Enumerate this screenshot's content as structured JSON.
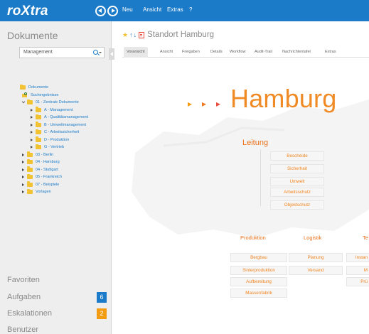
{
  "app": {
    "logo": "roXtra"
  },
  "topbar": {
    "menu": [
      "Neu",
      "Ansicht",
      "Extras",
      "?"
    ]
  },
  "sidebar": {
    "title": "Dokumente",
    "search": {
      "value": "Management"
    },
    "tree": [
      {
        "label": "Dokumente",
        "level": 0,
        "state": "none",
        "icon": "folder"
      },
      {
        "label": "Suchergebnisse",
        "level": 1,
        "state": "none",
        "icon": "search-folder"
      },
      {
        "label": "01 - Zentrale Dokumente",
        "level": 1,
        "state": "expanded",
        "icon": "folder"
      },
      {
        "label": "A - Management",
        "level": 2,
        "state": "collapsed",
        "icon": "folder"
      },
      {
        "label": "A - Qualitätsmanagement",
        "level": 2,
        "state": "collapsed",
        "icon": "folder"
      },
      {
        "label": "B - Umweltmanagement",
        "level": 2,
        "state": "collapsed",
        "icon": "folder"
      },
      {
        "label": "C - Arbeitssicherheit",
        "level": 2,
        "state": "collapsed",
        "icon": "folder"
      },
      {
        "label": "D - Produktion",
        "level": 2,
        "state": "collapsed",
        "icon": "folder"
      },
      {
        "label": "G - Vertrieb",
        "level": 2,
        "state": "collapsed",
        "icon": "folder"
      },
      {
        "label": "03 - Berlin",
        "level": 0,
        "state": "collapsed",
        "icon": "folder"
      },
      {
        "label": "04 - Hamburg",
        "level": 0,
        "state": "collapsed",
        "icon": "folder"
      },
      {
        "label": "04 - Stuttgart",
        "level": 0,
        "state": "collapsed",
        "icon": "folder"
      },
      {
        "label": "05 - Frankreich",
        "level": 0,
        "state": "collapsed",
        "icon": "folder"
      },
      {
        "label": "07 - Beispiele",
        "level": 0,
        "state": "collapsed",
        "icon": "folder"
      },
      {
        "label": "Vorlagen",
        "level": 0,
        "state": "collapsed",
        "icon": "folder"
      }
    ],
    "bottom": {
      "favoriten": "Favoriten",
      "aufgaben": "Aufgaben",
      "aufgaben_count": "6",
      "eskalationen": "Eskalationen",
      "eskalationen_count": "2",
      "benutzer": "Benutzer"
    }
  },
  "main": {
    "doc_title": "Standort Hamburg",
    "tabs": [
      "Voransicht",
      "Ansicht",
      "Freigaben",
      "Details",
      "Workflow",
      "Audit-Trail",
      "Nachrichtentafel",
      "Extras"
    ],
    "active_tab": "Voransicht",
    "org": {
      "city": "Hamburg",
      "leitung": {
        "title": "Leitung",
        "items": [
          "Bescheide",
          "Sicherheit",
          "Umwelt",
          "Arbeitsschutz",
          "Objektschutz"
        ]
      },
      "produktion": {
        "title": "Produktion",
        "items": [
          "Bergbau",
          "Sinterproduktion",
          "Aufbereitung",
          "Massenfabrik"
        ]
      },
      "logistik": {
        "title": "Logistik",
        "items": [
          "Planung",
          "Versand"
        ]
      },
      "technik_partial": {
        "title": "Te",
        "items": [
          "Instan",
          "M",
          "Prü"
        ]
      }
    }
  },
  "colors": {
    "brand_blue": "#1b7bc8",
    "accent_orange": "#f08a24",
    "badge_orange": "#f39c12"
  }
}
